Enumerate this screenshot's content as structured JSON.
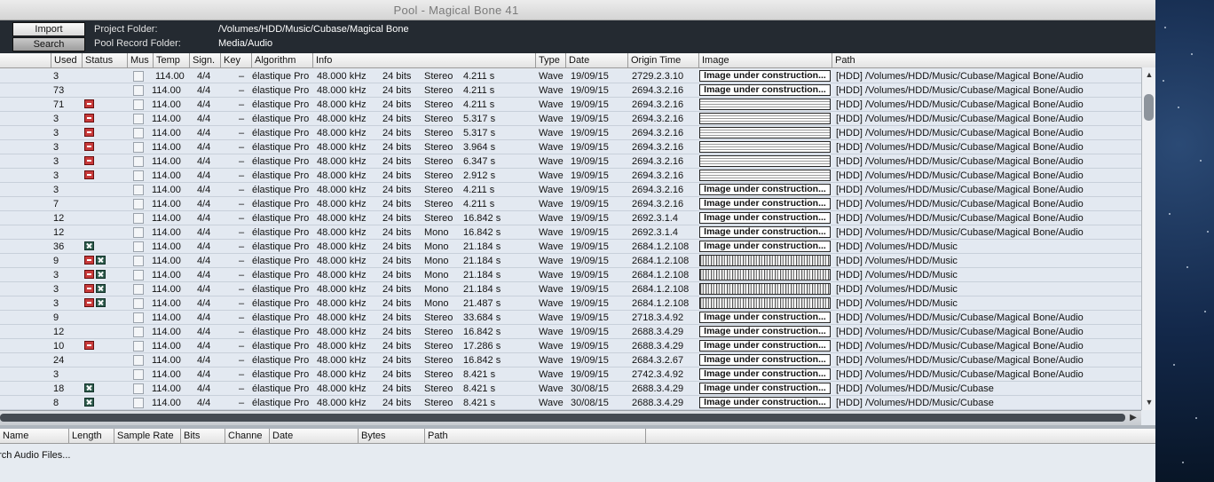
{
  "window": {
    "title": "Pool - Magical Bone 41"
  },
  "infobar": {
    "import_label": "Import",
    "search_label": "Search",
    "project_folder_label": "Project Folder:",
    "project_folder_value": "/Volumes/HDD/Music/Cubase/Magical Bone",
    "pool_record_label": "Pool Record Folder:",
    "pool_record_value": "Media/Audio"
  },
  "columns": [
    "Used",
    "Status",
    "Mus",
    "Temp",
    "Sign.",
    "Key",
    "Algorithm",
    "Info",
    "Type",
    "Date",
    "Origin Time",
    "Image",
    "Path"
  ],
  "rows": [
    {
      "used": "3",
      "status": [],
      "tempo": "  114.00",
      "sign": "4/4",
      "key": "–",
      "algorithm": "élastique Pro",
      "rate": "48.000 kHz",
      "bits": "24 bits",
      "channels": "Stereo",
      "length": "4.211 s",
      "type": "Wave",
      "date": "19/09/15",
      "origin": "2729.2.3.10",
      "image": "uc",
      "path": "[HDD] /Volumes/HDD/Music/Cubase/Magical Bone/Audio"
    },
    {
      "used": "73",
      "status": [],
      "tempo": "114.00",
      "sign": "4/4",
      "key": "–",
      "algorithm": "élastique Pro",
      "rate": "48.000 kHz",
      "bits": "24 bits",
      "channels": "Stereo",
      "length": "4.211 s",
      "type": "Wave",
      "date": "19/09/15",
      "origin": "2694.3.2.16",
      "image": "uc",
      "path": "[HDD] /Volumes/HDD/Music/Cubase/Magical Bone/Audio"
    },
    {
      "used": "71",
      "status": [
        "rec"
      ],
      "tempo": "114.00",
      "sign": "4/4",
      "key": "–",
      "algorithm": "élastique Pro",
      "rate": "48.000 kHz",
      "bits": "24 bits",
      "channels": "Stereo",
      "length": "4.211 s",
      "type": "Wave",
      "date": "19/09/15",
      "origin": "2694.3.2.16",
      "image": "blank",
      "path": "[HDD] /Volumes/HDD/Music/Cubase/Magical Bone/Audio"
    },
    {
      "used": "3",
      "status": [
        "rec"
      ],
      "tempo": "114.00",
      "sign": "4/4",
      "key": "–",
      "algorithm": "élastique Pro",
      "rate": "48.000 kHz",
      "bits": "24 bits",
      "channels": "Stereo",
      "length": "5.317 s",
      "type": "Wave",
      "date": "19/09/15",
      "origin": "2694.3.2.16",
      "image": "blank",
      "path": "[HDD] /Volumes/HDD/Music/Cubase/Magical Bone/Audio"
    },
    {
      "used": "3",
      "status": [
        "rec"
      ],
      "tempo": "114.00",
      "sign": "4/4",
      "key": "–",
      "algorithm": "élastique Pro",
      "rate": "48.000 kHz",
      "bits": "24 bits",
      "channels": "Stereo",
      "length": "5.317 s",
      "type": "Wave",
      "date": "19/09/15",
      "origin": "2694.3.2.16",
      "image": "blank",
      "path": "[HDD] /Volumes/HDD/Music/Cubase/Magical Bone/Audio"
    },
    {
      "used": "3",
      "status": [
        "rec"
      ],
      "tempo": "114.00",
      "sign": "4/4",
      "key": "–",
      "algorithm": "élastique Pro",
      "rate": "48.000 kHz",
      "bits": "24 bits",
      "channels": "Stereo",
      "length": "3.964 s",
      "type": "Wave",
      "date": "19/09/15",
      "origin": "2694.3.2.16",
      "image": "blank",
      "path": "[HDD] /Volumes/HDD/Music/Cubase/Magical Bone/Audio"
    },
    {
      "used": "3",
      "status": [
        "rec"
      ],
      "tempo": "114.00",
      "sign": "4/4",
      "key": "–",
      "algorithm": "élastique Pro",
      "rate": "48.000 kHz",
      "bits": "24 bits",
      "channels": "Stereo",
      "length": "6.347 s",
      "type": "Wave",
      "date": "19/09/15",
      "origin": "2694.3.2.16",
      "image": "blank",
      "path": "[HDD] /Volumes/HDD/Music/Cubase/Magical Bone/Audio"
    },
    {
      "used": "3",
      "status": [
        "rec"
      ],
      "tempo": "114.00",
      "sign": "4/4",
      "key": "–",
      "algorithm": "élastique Pro",
      "rate": "48.000 kHz",
      "bits": "24 bits",
      "channels": "Stereo",
      "length": "2.912 s",
      "type": "Wave",
      "date": "19/09/15",
      "origin": "2694.3.2.16",
      "image": "blank",
      "path": "[HDD] /Volumes/HDD/Music/Cubase/Magical Bone/Audio"
    },
    {
      "used": "3",
      "status": [],
      "tempo": "114.00",
      "sign": "4/4",
      "key": "–",
      "algorithm": "élastique Pro",
      "rate": "48.000 kHz",
      "bits": "24 bits",
      "channels": "Stereo",
      "length": "4.211 s",
      "type": "Wave",
      "date": "19/09/15",
      "origin": "2694.3.2.16",
      "image": "uc",
      "path": "[HDD] /Volumes/HDD/Music/Cubase/Magical Bone/Audio"
    },
    {
      "used": "7",
      "status": [],
      "tempo": "114.00",
      "sign": "4/4",
      "key": "–",
      "algorithm": "élastique Pro",
      "rate": "48.000 kHz",
      "bits": "24 bits",
      "channels": "Stereo",
      "length": "4.211 s",
      "type": "Wave",
      "date": "19/09/15",
      "origin": "2694.3.2.16",
      "image": "uc",
      "path": "[HDD] /Volumes/HDD/Music/Cubase/Magical Bone/Audio"
    },
    {
      "used": "12",
      "status": [],
      "tempo": "114.00",
      "sign": "4/4",
      "key": "–",
      "algorithm": "élastique Pro",
      "rate": "48.000 kHz",
      "bits": "24 bits",
      "channels": "Stereo",
      "length": "16.842 s",
      "type": "Wave",
      "date": "19/09/15",
      "origin": "2692.3.1.4",
      "image": "uc",
      "path": "[HDD] /Volumes/HDD/Music/Cubase/Magical Bone/Audio"
    },
    {
      "used": "12",
      "status": [],
      "tempo": "114.00",
      "sign": "4/4",
      "key": "–",
      "algorithm": "élastique Pro",
      "rate": "48.000 kHz",
      "bits": "24 bits",
      "channels": "Mono",
      "length": "16.842 s",
      "type": "Wave",
      "date": "19/09/15",
      "origin": "2692.3.1.4",
      "image": "uc",
      "path": "[HDD] /Volumes/HDD/Music/Cubase/Magical Bone/Audio"
    },
    {
      "used": "36",
      "status": [
        "x"
      ],
      "tempo": "114.00",
      "sign": "4/4",
      "key": "–",
      "algorithm": "élastique Pro",
      "rate": "48.000 kHz",
      "bits": "24 bits",
      "channels": "Mono",
      "length": "21.184 s",
      "type": "Wave",
      "date": "19/09/15",
      "origin": "2684.1.2.108",
      "image": "uc",
      "path": "[HDD] /Volumes/HDD/Music"
    },
    {
      "used": "9",
      "status": [
        "rec",
        "x"
      ],
      "tempo": "114.00",
      "sign": "4/4",
      "key": "–",
      "algorithm": "élastique Pro",
      "rate": "48.000 kHz",
      "bits": "24 bits",
      "channels": "Mono",
      "length": "21.184 s",
      "type": "Wave",
      "date": "19/09/15",
      "origin": "2684.1.2.108",
      "image": "wave",
      "path": "[HDD] /Volumes/HDD/Music"
    },
    {
      "used": "3",
      "status": [
        "rec",
        "x"
      ],
      "tempo": "114.00",
      "sign": "4/4",
      "key": "–",
      "algorithm": "élastique Pro",
      "rate": "48.000 kHz",
      "bits": "24 bits",
      "channels": "Mono",
      "length": "21.184 s",
      "type": "Wave",
      "date": "19/09/15",
      "origin": "2684.1.2.108",
      "image": "wave",
      "path": "[HDD] /Volumes/HDD/Music"
    },
    {
      "used": "3",
      "status": [
        "rec",
        "x"
      ],
      "tempo": "114.00",
      "sign": "4/4",
      "key": "–",
      "algorithm": "élastique Pro",
      "rate": "48.000 kHz",
      "bits": "24 bits",
      "channels": "Mono",
      "length": "21.184 s",
      "type": "Wave",
      "date": "19/09/15",
      "origin": "2684.1.2.108",
      "image": "wave",
      "path": "[HDD] /Volumes/HDD/Music"
    },
    {
      "used": "3",
      "status": [
        "rec",
        "x"
      ],
      "tempo": "114.00",
      "sign": "4/4",
      "key": "–",
      "algorithm": "élastique Pro",
      "rate": "48.000 kHz",
      "bits": "24 bits",
      "channels": "Mono",
      "length": "21.487 s",
      "type": "Wave",
      "date": "19/09/15",
      "origin": "2684.1.2.108",
      "image": "wave",
      "path": "[HDD] /Volumes/HDD/Music"
    },
    {
      "used": "9",
      "status": [],
      "tempo": "114.00",
      "sign": "4/4",
      "key": "–",
      "algorithm": "élastique Pro",
      "rate": "48.000 kHz",
      "bits": "24 bits",
      "channels": "Stereo",
      "length": "33.684 s",
      "type": "Wave",
      "date": "19/09/15",
      "origin": "2718.3.4.92",
      "image": "uc",
      "path": "[HDD] /Volumes/HDD/Music/Cubase/Magical Bone/Audio"
    },
    {
      "used": "12",
      "status": [],
      "tempo": "114.00",
      "sign": "4/4",
      "key": "–",
      "algorithm": "élastique Pro",
      "rate": "48.000 kHz",
      "bits": "24 bits",
      "channels": "Stereo",
      "length": "16.842 s",
      "type": "Wave",
      "date": "19/09/15",
      "origin": "2688.3.4.29",
      "image": "uc",
      "path": "[HDD] /Volumes/HDD/Music/Cubase/Magical Bone/Audio"
    },
    {
      "used": "10",
      "status": [
        "rec"
      ],
      "tempo": "114.00",
      "sign": "4/4",
      "key": "–",
      "algorithm": "élastique Pro",
      "rate": "48.000 kHz",
      "bits": "24 bits",
      "channels": "Stereo",
      "length": "17.286 s",
      "type": "Wave",
      "date": "19/09/15",
      "origin": "2688.3.4.29",
      "image": "uc",
      "path": "[HDD] /Volumes/HDD/Music/Cubase/Magical Bone/Audio"
    },
    {
      "used": "24",
      "status": [],
      "tempo": "114.00",
      "sign": "4/4",
      "key": "–",
      "algorithm": "élastique Pro",
      "rate": "48.000 kHz",
      "bits": "24 bits",
      "channels": "Stereo",
      "length": "16.842 s",
      "type": "Wave",
      "date": "19/09/15",
      "origin": "2684.3.2.67",
      "image": "uc",
      "path": "[HDD] /Volumes/HDD/Music/Cubase/Magical Bone/Audio"
    },
    {
      "used": "3",
      "status": [],
      "tempo": "114.00",
      "sign": "4/4",
      "key": "–",
      "algorithm": "élastique Pro",
      "rate": "48.000 kHz",
      "bits": "24 bits",
      "channels": "Stereo",
      "length": "8.421 s",
      "type": "Wave",
      "date": "19/09/15",
      "origin": "2742.3.4.92",
      "image": "uc",
      "path": "[HDD] /Volumes/HDD/Music/Cubase/Magical Bone/Audio"
    },
    {
      "used": "18",
      "status": [
        "x"
      ],
      "tempo": "114.00",
      "sign": "4/4",
      "key": "–",
      "algorithm": "élastique Pro",
      "rate": "48.000 kHz",
      "bits": "24 bits",
      "channels": "Stereo",
      "length": "8.421 s",
      "type": "Wave",
      "date": "30/08/15",
      "origin": "2688.3.4.29",
      "image": "uc",
      "path": "[HDD] /Volumes/HDD/Music/Cubase"
    },
    {
      "used": "8",
      "status": [
        "x"
      ],
      "tempo": "114.00",
      "sign": "4/4",
      "key": "–",
      "algorithm": "élastique Pro",
      "rate": "48.000 kHz",
      "bits": "24 bits",
      "channels": "Stereo",
      "length": "8.421 s",
      "type": "Wave",
      "date": "30/08/15",
      "origin": "2688.3.4.29",
      "image": "uc",
      "path": "[HDD] /Volumes/HDD/Music/Cubase"
    }
  ],
  "image_text": "Image under construction...",
  "search_columns": [
    "Name",
    "Length",
    "Sample Rate",
    "Bits",
    "Channe",
    "Date",
    "Bytes",
    "Path"
  ],
  "status_text": "arch Audio Files...",
  "scroll": {
    "up": "▲",
    "down": "▼",
    "right": "▶"
  }
}
